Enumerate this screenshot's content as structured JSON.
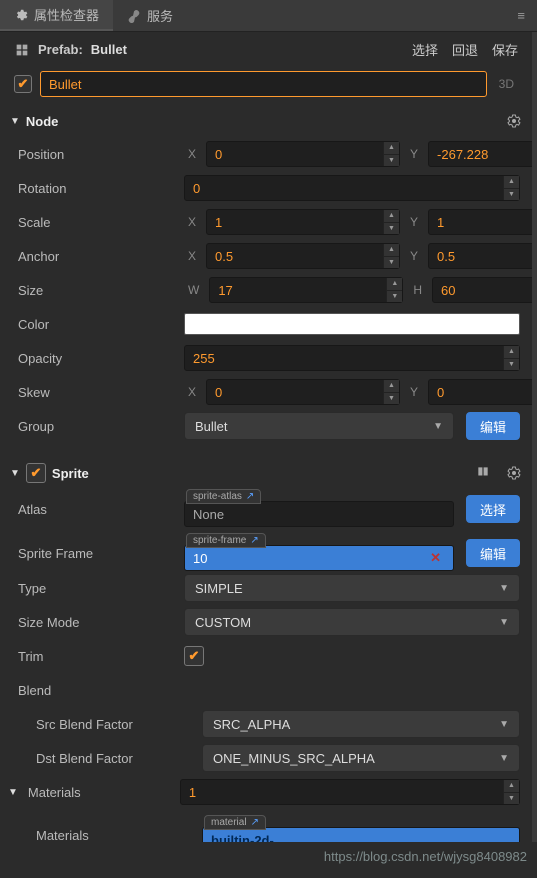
{
  "tabs": {
    "inspector": "属性检查器",
    "services": "服务"
  },
  "header": {
    "prefab_label": "Prefab:",
    "prefab_name": "Bullet",
    "select": "选择",
    "revert": "回退",
    "save": "保存"
  },
  "name_row": {
    "value": "Bullet",
    "dim": "3D"
  },
  "node": {
    "title": "Node",
    "position": {
      "label": "Position",
      "x": "0",
      "y": "-267.228"
    },
    "rotation": {
      "label": "Rotation",
      "value": "0"
    },
    "scale": {
      "label": "Scale",
      "x": "1",
      "y": "1"
    },
    "anchor": {
      "label": "Anchor",
      "x": "0.5",
      "y": "0.5"
    },
    "size": {
      "label": "Size",
      "w": "17",
      "h": "60"
    },
    "color": {
      "label": "Color",
      "value": "#ffffff"
    },
    "opacity": {
      "label": "Opacity",
      "value": "255"
    },
    "skew": {
      "label": "Skew",
      "x": "0",
      "y": "0"
    },
    "group": {
      "label": "Group",
      "value": "Bullet",
      "edit": "编辑"
    },
    "axis": {
      "x": "X",
      "y": "Y",
      "w": "W",
      "h": "H"
    }
  },
  "sprite": {
    "title": "Sprite",
    "atlas": {
      "label": "Atlas",
      "tag": "sprite-atlas",
      "value": "None",
      "select": "选择"
    },
    "frame": {
      "label": "Sprite Frame",
      "tag": "sprite-frame",
      "value": "10",
      "edit": "编辑"
    },
    "type": {
      "label": "Type",
      "value": "SIMPLE"
    },
    "sizeMode": {
      "label": "Size Mode",
      "value": "CUSTOM"
    },
    "trim": {
      "label": "Trim"
    },
    "blend": {
      "label": "Blend",
      "src_label": "Src Blend Factor",
      "src": "SRC_ALPHA",
      "dst_label": "Dst Blend Factor",
      "dst": "ONE_MINUS_SRC_ALPHA"
    },
    "materials": {
      "label": "Materials",
      "value": "1",
      "item_label": "Materials",
      "tag": "material",
      "item": "builtin-2d-"
    }
  },
  "watermark": "https://blog.csdn.net/wjysg8408982"
}
